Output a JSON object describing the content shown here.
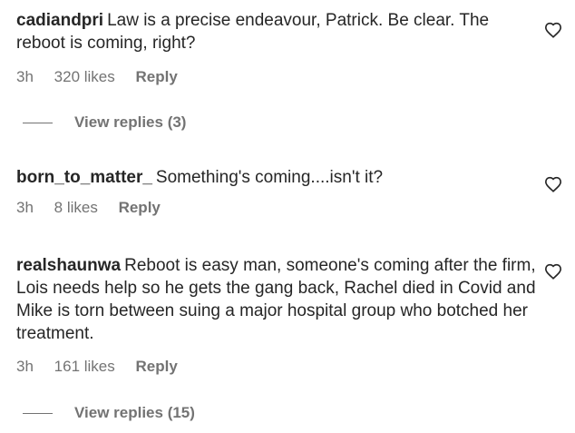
{
  "comments": [
    {
      "username": "cadiandpri",
      "text": "Law is a precise endeavour, Patrick. Be clear. The reboot is coming, right?",
      "time": "3h",
      "likes": "320 likes",
      "reply": "Reply",
      "view_replies": "View replies (3)"
    },
    {
      "username": "born_to_matter_",
      "text": "Something's coming....isn't it?",
      "time": "3h",
      "likes": "8 likes",
      "reply": "Reply"
    },
    {
      "username": "realshaunwa",
      "text": "Reboot is easy man, someone's coming after the firm, Lois needs help so he gets the gang back, Rachel died in Covid and Mike is torn between suing a major hospital group who botched her treatment.",
      "time": "3h",
      "likes": "161 likes",
      "reply": "Reply",
      "view_replies": "View replies (15)"
    }
  ],
  "icons": {
    "like": "heart-outline-icon"
  },
  "colors": {
    "text": "#262626",
    "secondary": "#737373",
    "background": "#ffffff"
  }
}
